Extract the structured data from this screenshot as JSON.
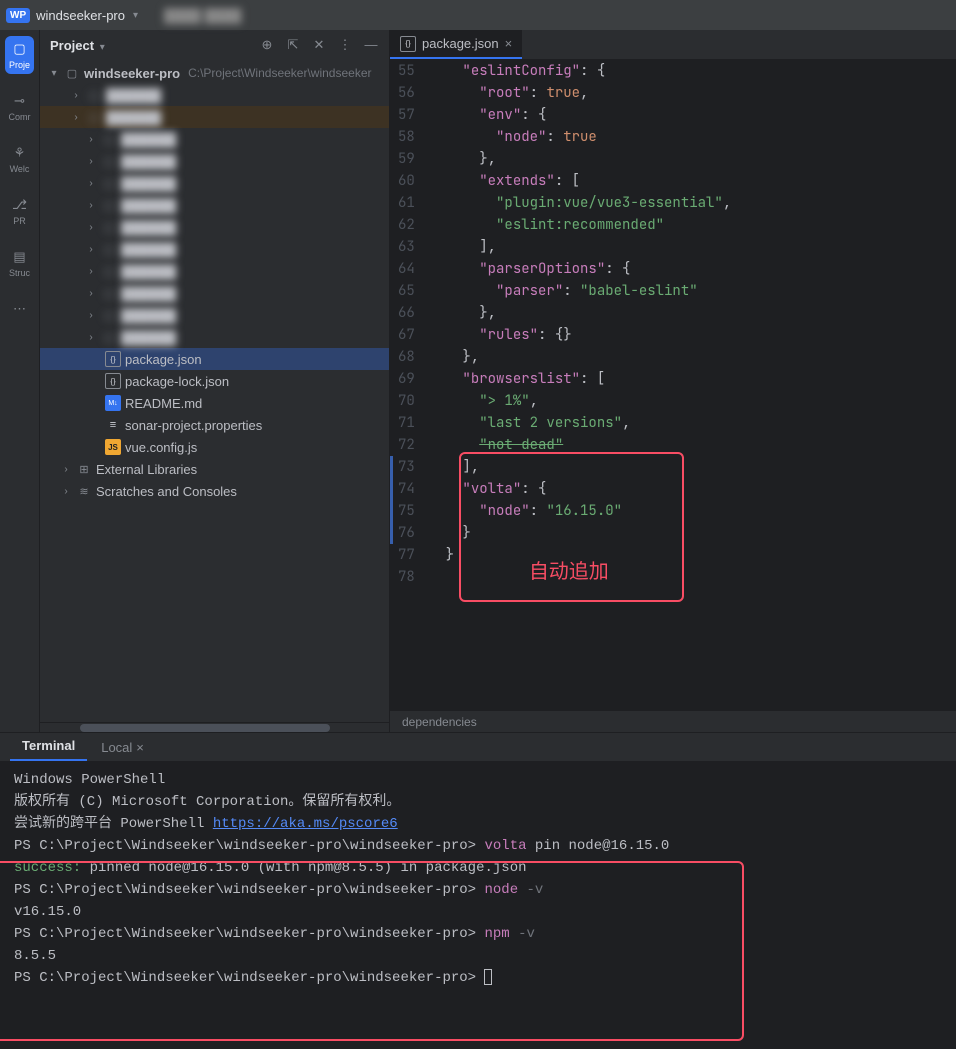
{
  "titlebar": {
    "badge": "WP",
    "project": "windseeker-pro"
  },
  "leftbar": [
    {
      "icon": "folder",
      "label": "Proje",
      "active": true
    },
    {
      "icon": "commit",
      "label": "Comr"
    },
    {
      "icon": "welcome",
      "label": "Welc"
    },
    {
      "icon": "pr",
      "label": "PR"
    },
    {
      "icon": "struct",
      "label": "Struc"
    },
    {
      "icon": "more",
      "label": ""
    }
  ],
  "panel": {
    "title": "Project",
    "root": {
      "name": "windseeker-pro",
      "path": "C:\\Project\\Windseeker\\windseeker"
    },
    "files": [
      {
        "name": "package.json",
        "icon": "json",
        "indent": 3,
        "sel": true
      },
      {
        "name": "package-lock.json",
        "icon": "json",
        "indent": 3
      },
      {
        "name": "README.md",
        "icon": "md",
        "indent": 3
      },
      {
        "name": "sonar-project.properties",
        "icon": "prop",
        "indent": 3
      },
      {
        "name": "vue.config.js",
        "icon": "js",
        "indent": 3
      }
    ],
    "extras": [
      {
        "name": "External Libraries",
        "icon": "lib"
      },
      {
        "name": "Scratches and Consoles",
        "icon": "scratch"
      }
    ]
  },
  "tab": {
    "name": "package.json"
  },
  "code": {
    "lines": [
      {
        "n": 55,
        "seg": [
          {
            "t": "    ",
            "c": "p"
          },
          {
            "t": "\"eslintConfig\"",
            "c": "k"
          },
          {
            "t": ": {",
            "c": "p"
          }
        ]
      },
      {
        "n": 56,
        "seg": [
          {
            "t": "      ",
            "c": "p"
          },
          {
            "t": "\"root\"",
            "c": "k"
          },
          {
            "t": ": ",
            "c": "p"
          },
          {
            "t": "true",
            "c": "b"
          },
          {
            "t": ",",
            "c": "p"
          }
        ]
      },
      {
        "n": 57,
        "seg": [
          {
            "t": "      ",
            "c": "p"
          },
          {
            "t": "\"env\"",
            "c": "k"
          },
          {
            "t": ": {",
            "c": "p"
          }
        ]
      },
      {
        "n": 58,
        "seg": [
          {
            "t": "        ",
            "c": "p"
          },
          {
            "t": "\"node\"",
            "c": "k"
          },
          {
            "t": ": ",
            "c": "p"
          },
          {
            "t": "true",
            "c": "b"
          }
        ]
      },
      {
        "n": 59,
        "seg": [
          {
            "t": "      },",
            "c": "p"
          }
        ]
      },
      {
        "n": 60,
        "seg": [
          {
            "t": "      ",
            "c": "p"
          },
          {
            "t": "\"extends\"",
            "c": "k"
          },
          {
            "t": ": [",
            "c": "p"
          }
        ]
      },
      {
        "n": 61,
        "seg": [
          {
            "t": "        ",
            "c": "p"
          },
          {
            "t": "\"plugin:vue/vue3-essential\"",
            "c": "s"
          },
          {
            "t": ",",
            "c": "p"
          }
        ]
      },
      {
        "n": 62,
        "seg": [
          {
            "t": "        ",
            "c": "p"
          },
          {
            "t": "\"eslint:recommended\"",
            "c": "s"
          }
        ]
      },
      {
        "n": 63,
        "seg": [
          {
            "t": "      ],",
            "c": "p"
          }
        ]
      },
      {
        "n": 64,
        "seg": [
          {
            "t": "      ",
            "c": "p"
          },
          {
            "t": "\"parserOptions\"",
            "c": "k"
          },
          {
            "t": ": {",
            "c": "p"
          }
        ]
      },
      {
        "n": 65,
        "seg": [
          {
            "t": "        ",
            "c": "p"
          },
          {
            "t": "\"parser\"",
            "c": "k"
          },
          {
            "t": ": ",
            "c": "p"
          },
          {
            "t": "\"babel-eslint\"",
            "c": "s"
          }
        ]
      },
      {
        "n": 66,
        "seg": [
          {
            "t": "      },",
            "c": "p"
          }
        ]
      },
      {
        "n": 67,
        "seg": [
          {
            "t": "      ",
            "c": "p"
          },
          {
            "t": "\"rules\"",
            "c": "k"
          },
          {
            "t": ": {}",
            "c": "p"
          }
        ]
      },
      {
        "n": 68,
        "seg": [
          {
            "t": "    },",
            "c": "p"
          }
        ]
      },
      {
        "n": 69,
        "seg": [
          {
            "t": "    ",
            "c": "p"
          },
          {
            "t": "\"browserslist\"",
            "c": "k"
          },
          {
            "t": ": [",
            "c": "p"
          }
        ]
      },
      {
        "n": 70,
        "seg": [
          {
            "t": "      ",
            "c": "p"
          },
          {
            "t": "\"> 1%\"",
            "c": "s"
          },
          {
            "t": ",",
            "c": "p"
          }
        ]
      },
      {
        "n": 71,
        "seg": [
          {
            "t": "      ",
            "c": "p"
          },
          {
            "t": "\"last 2 versions\"",
            "c": "s"
          },
          {
            "t": ",",
            "c": "p"
          }
        ]
      },
      {
        "n": 72,
        "seg": [
          {
            "t": "      ",
            "c": "p"
          },
          {
            "t": "\"not dead\"",
            "c": "st"
          }
        ]
      },
      {
        "n": 73,
        "mod": true,
        "seg": [
          {
            "t": "    ],",
            "c": "p"
          }
        ]
      },
      {
        "n": 74,
        "mod": true,
        "seg": [
          {
            "t": "    ",
            "c": "p"
          },
          {
            "t": "\"volta\"",
            "c": "k"
          },
          {
            "t": ": {",
            "c": "p"
          }
        ]
      },
      {
        "n": 75,
        "mod": true,
        "seg": [
          {
            "t": "      ",
            "c": "p"
          },
          {
            "t": "\"node\"",
            "c": "k"
          },
          {
            "t": ": ",
            "c": "p"
          },
          {
            "t": "\"16.15.0\"",
            "c": "s"
          }
        ]
      },
      {
        "n": 76,
        "mod": true,
        "seg": [
          {
            "t": "    }",
            "c": "p"
          }
        ]
      },
      {
        "n": 77,
        "seg": [
          {
            "t": "  }",
            "c": "p"
          }
        ]
      },
      {
        "n": 78,
        "seg": [
          {
            "t": "",
            "c": "p"
          }
        ]
      }
    ]
  },
  "annotation_label": "自动追加",
  "breadcrumb": "dependencies",
  "terminal": {
    "tabs": [
      {
        "name": "Terminal",
        "active": true
      },
      {
        "name": "Local",
        "closable": true
      }
    ],
    "lines": [
      {
        "seg": [
          {
            "t": "Windows PowerShell",
            "c": ""
          }
        ]
      },
      {
        "seg": [
          {
            "t": "版权所有 (C) Microsoft Corporation。保留所有权利。",
            "c": ""
          }
        ]
      },
      {
        "seg": [
          {
            "t": "",
            "c": ""
          }
        ]
      },
      {
        "seg": [
          {
            "t": "尝试新的跨平台 PowerShell ",
            "c": ""
          },
          {
            "t": "https://aka.ms/pscore6",
            "c": "t-link"
          }
        ]
      },
      {
        "seg": [
          {
            "t": "",
            "c": ""
          }
        ]
      },
      {
        "seg": [
          {
            "t": "PS C:\\Project\\Windseeker\\windseeker-pro\\windseeker-pro> ",
            "c": ""
          },
          {
            "t": "volta",
            "c": "t-volta"
          },
          {
            "t": " pin node@16.15.0",
            "c": ""
          }
        ]
      },
      {
        "seg": [
          {
            "t": "success:",
            "c": "t-success"
          },
          {
            "t": " pinned node@16.15.0 (with npm@8.5.5) in package.json",
            "c": ""
          }
        ]
      },
      {
        "seg": [
          {
            "t": "PS C:\\Project\\Windseeker\\windseeker-pro\\windseeker-pro> ",
            "c": ""
          },
          {
            "t": "node",
            "c": "t-volta"
          },
          {
            "t": " -v",
            "c": "t-flag"
          }
        ]
      },
      {
        "seg": [
          {
            "t": "v16.15.0",
            "c": ""
          }
        ]
      },
      {
        "seg": [
          {
            "t": "PS C:\\Project\\Windseeker\\windseeker-pro\\windseeker-pro> ",
            "c": ""
          },
          {
            "t": "npm",
            "c": "t-volta"
          },
          {
            "t": " -v",
            "c": "t-flag"
          }
        ]
      },
      {
        "seg": [
          {
            "t": "8.5.5",
            "c": ""
          }
        ]
      },
      {
        "seg": [
          {
            "t": "PS C:\\Project\\Windseeker\\windseeker-pro\\windseeker-pro> ",
            "c": ""
          }
        ],
        "cursor": true
      }
    ]
  }
}
